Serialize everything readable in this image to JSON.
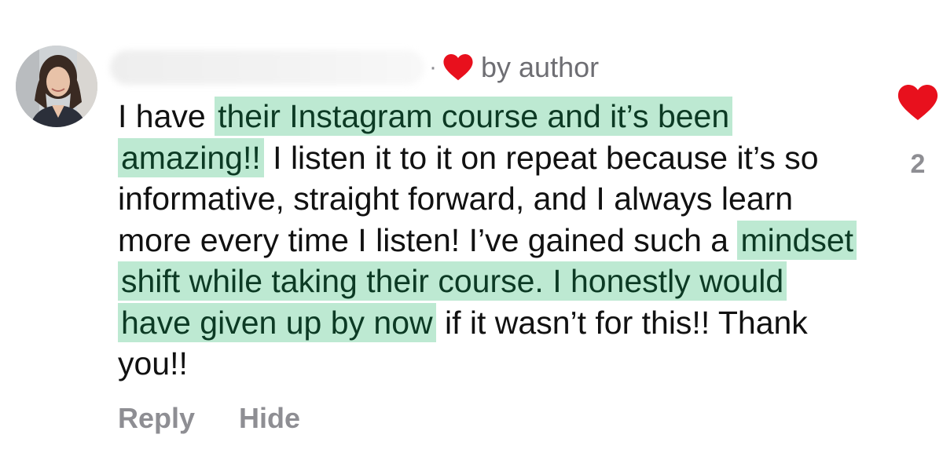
{
  "comment": {
    "author_name": "",
    "separator": "·",
    "author_liked_label": "by author",
    "text_segments": [
      {
        "text": "I have ",
        "highlight": false
      },
      {
        "text": "their Instagram course and it’s been amazing!!",
        "highlight": true
      },
      {
        "text": " I listen it to it on repeat because it’s so informative, straight forward, and I always learn more every time I listen! I’ve gained such a ",
        "highlight": false
      },
      {
        "text": "mindset shift while taking their course. I honestly would have given up by now",
        "highlight": true
      },
      {
        "text": " if it wasn’t for this!! Thank you!!",
        "highlight": false
      }
    ],
    "actions": {
      "reply_label": "Reply",
      "hide_label": "Hide"
    },
    "like": {
      "count": "2",
      "icon": "heart-icon",
      "color": "#e8101d"
    },
    "highlight_color": "#bde9d2",
    "avatar": "avatar"
  }
}
